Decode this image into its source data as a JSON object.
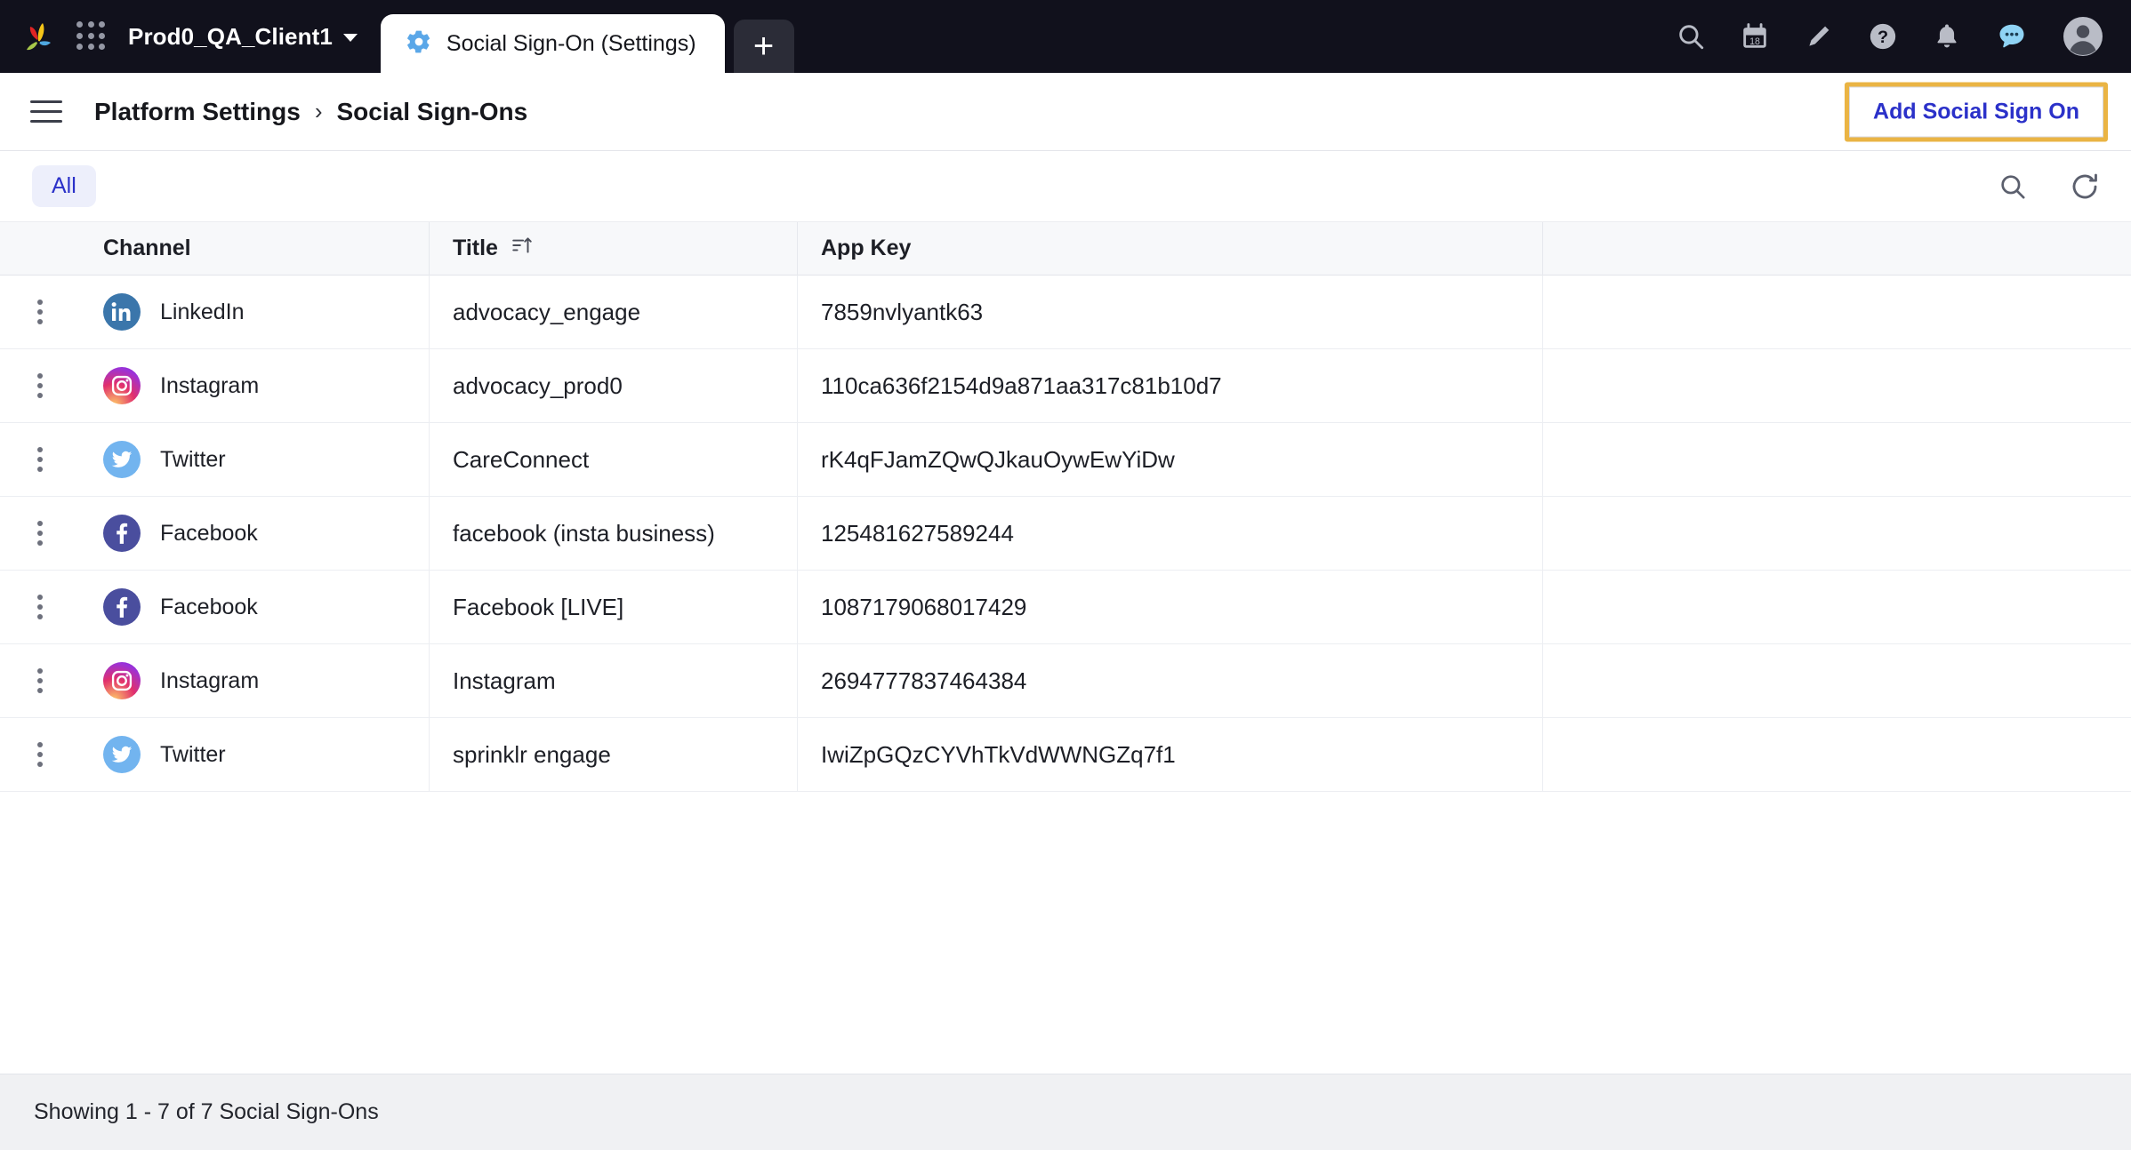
{
  "topbar": {
    "logo_name": "sprinklr-logo",
    "workspace": "Prod0_QA_Client1",
    "tab": {
      "label": "Social Sign-On (Settings)",
      "icon": "gear-icon"
    },
    "add_tab_label": "+",
    "icons": [
      {
        "name": "search-icon",
        "label": "Search"
      },
      {
        "name": "calendar-icon",
        "label": "18"
      },
      {
        "name": "pencil-icon",
        "label": "Compose"
      },
      {
        "name": "help-icon",
        "label": "Help"
      },
      {
        "name": "bell-icon",
        "label": "Notifications"
      },
      {
        "name": "chat-icon",
        "label": "Messages"
      },
      {
        "name": "avatar-icon",
        "label": "Profile"
      }
    ]
  },
  "breadcrumb": {
    "menu_icon": "hamburger-icon",
    "items": [
      "Platform Settings",
      "Social Sign-Ons"
    ],
    "separator": "›",
    "add_button": "Add Social Sign On",
    "highlight_color": "#eab444",
    "link_color": "#2b31c9"
  },
  "filters": {
    "tabs": [
      {
        "label": "All",
        "active": true
      }
    ],
    "search_icon": "search-icon",
    "refresh_icon": "refresh-icon"
  },
  "table": {
    "columns": [
      "",
      "Channel",
      "Title",
      "App Key",
      ""
    ],
    "sort": {
      "column": "Title",
      "icon": "sort-ascending-icon",
      "direction": "asc"
    },
    "rows": [
      {
        "channel": "LinkedIn",
        "network": "linkedin",
        "title": "advocacy_engage",
        "app_key": "7859nvlyantk63"
      },
      {
        "channel": "Instagram",
        "network": "instagram",
        "title": "advocacy_prod0",
        "app_key": "110ca636f2154d9a871aa317c81b10d7"
      },
      {
        "channel": "Twitter",
        "network": "twitter",
        "title": "CareConnect",
        "app_key": "rK4qFJamZQwQJkauOywEwYiDw"
      },
      {
        "channel": "Facebook",
        "network": "facebook",
        "title": "facebook (insta business)",
        "app_key": "125481627589244"
      },
      {
        "channel": "Facebook",
        "network": "facebook",
        "title": "Facebook [LIVE]",
        "app_key": "1087179068017429"
      },
      {
        "channel": "Instagram",
        "network": "instagram",
        "title": "Instagram",
        "app_key": "2694777837464384"
      },
      {
        "channel": "Twitter",
        "network": "twitter",
        "title": "sprinklr engage",
        "app_key": "IwiZpGQzCYVhTkVdWWNGZq7f1"
      }
    ]
  },
  "footer": {
    "status": "Showing 1 - 7 of 7 Social Sign-Ons"
  }
}
